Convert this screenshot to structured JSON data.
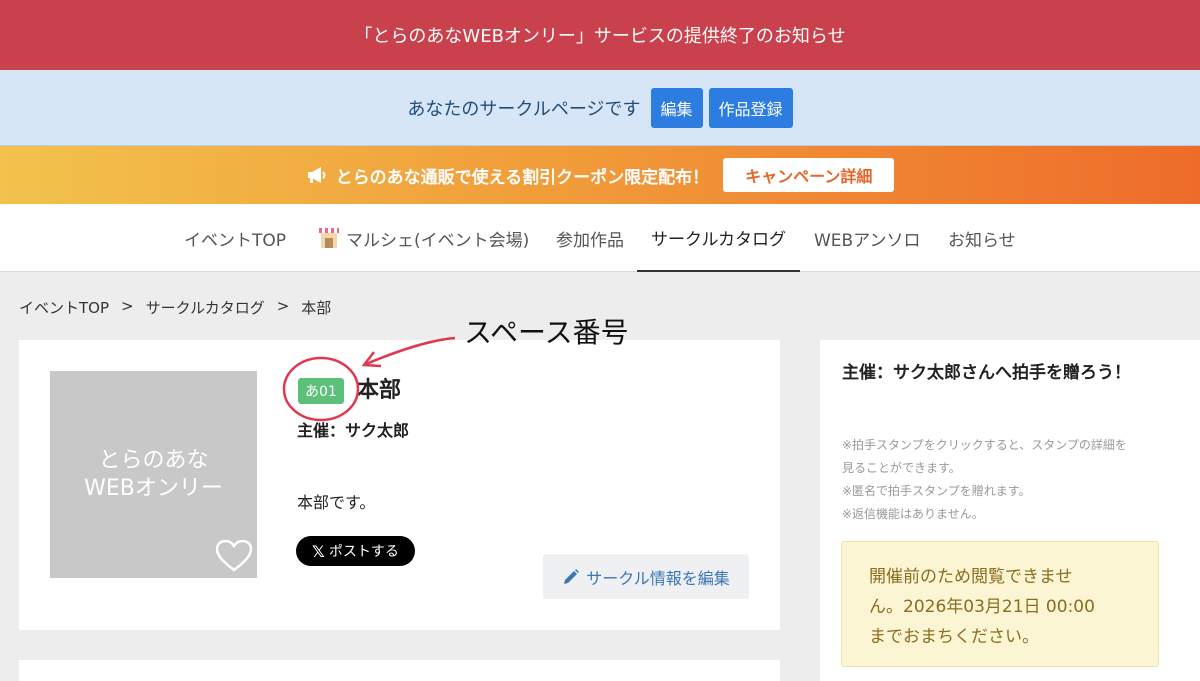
{
  "notice_banner": {
    "text": "「とらのあなWEBオンリー」サービスの提供終了のお知らせ"
  },
  "owner_bar": {
    "text": "あなたのサークルページです",
    "edit_label": "編集",
    "register_label": "作品登録"
  },
  "campaign_bar": {
    "text": "とらのあな通販で使える割引クーポン限定配布！",
    "button_label": "キャンペーン詳細"
  },
  "nav": {
    "items": [
      {
        "label": "イベントTOP"
      },
      {
        "label": "マルシェ(イベント会場)"
      },
      {
        "label": "参加作品"
      },
      {
        "label": "サークルカタログ"
      },
      {
        "label": "WEBアンソロ"
      },
      {
        "label": "お知らせ"
      }
    ],
    "active": "サークルカタログ"
  },
  "breadcrumb": {
    "items": [
      "イベントTOP",
      ">",
      "サークルカタログ",
      ">",
      "本部"
    ]
  },
  "circle": {
    "thumbnail_logo_line1": "とらのあな",
    "thumbnail_logo_line2": "WEBオンリー",
    "space_number": "あ01",
    "name": "本部",
    "organizer": "主催：サク太郎",
    "description": "本部です。",
    "x_post_label": "ポストする",
    "x_logo": "𝕏",
    "edit_label": "サークル情報を編集"
  },
  "sidebar": {
    "title": "主催：サク太郎さんへ拍手を贈ろう！",
    "notes": [
      "※拍手スタンプをクリックすると、スタンプの詳細を",
      "見ることができます。",
      "※匿名で拍手スタンプを贈れます。",
      "※返信機能はありません。"
    ],
    "alert_lines": [
      "開催前のため閲覧できませ",
      "ん。2026年03月21日 00:00",
      "までおまちください。"
    ]
  },
  "annotation": {
    "text": "スペース番号",
    "color": "#e0384f"
  },
  "colors": {
    "notice": "#c9414c",
    "accent_blue": "#2d7de0",
    "campaign_orange": "#ee6c2a",
    "badge_green": "#5cbf7a"
  },
  "icons": [
    "megaphone-icon",
    "marche-shop-icon",
    "heart-icon",
    "pencil-icon",
    "x-logo-icon"
  ]
}
